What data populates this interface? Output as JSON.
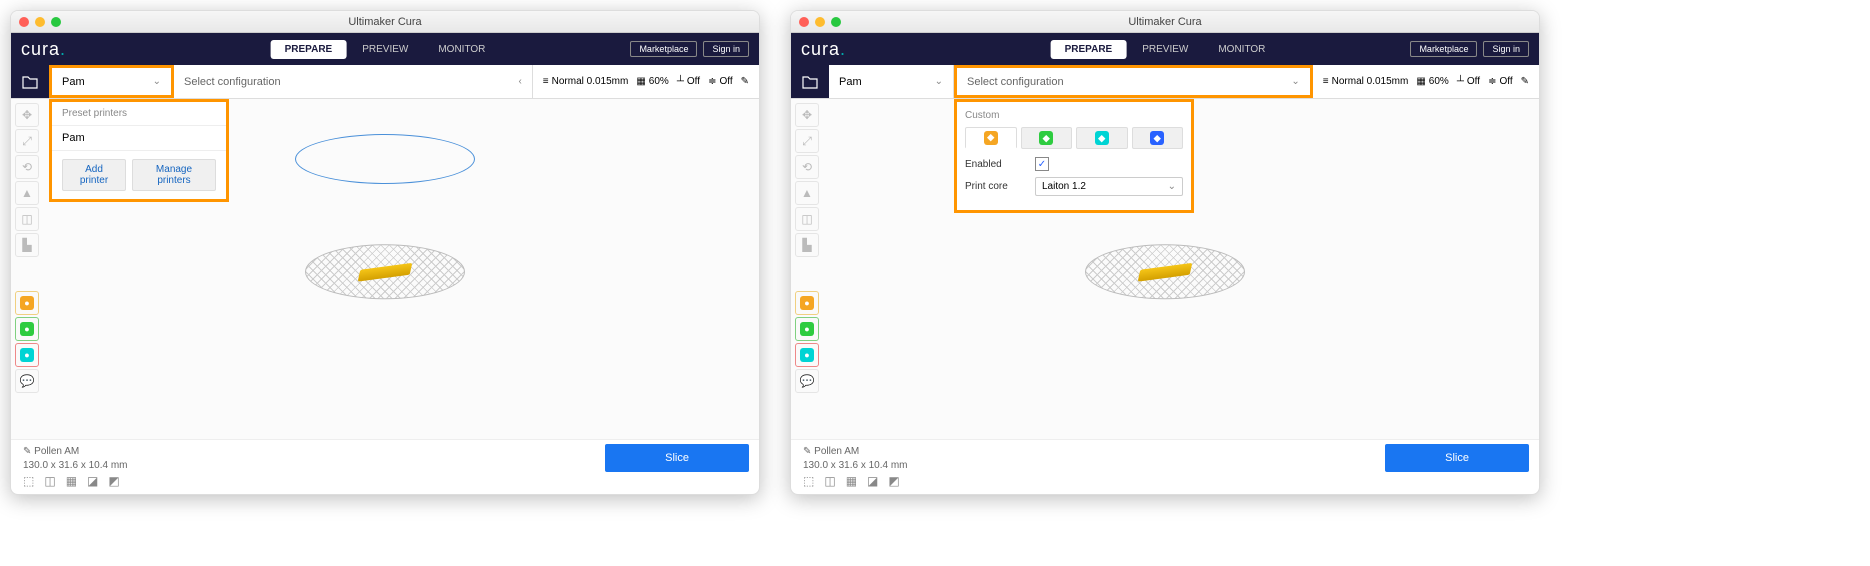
{
  "window": {
    "title": "Ultimaker Cura"
  },
  "logo": "cura",
  "stages": {
    "prepare": "PREPARE",
    "preview": "PREVIEW",
    "monitor": "MONITOR"
  },
  "top_buttons": {
    "marketplace": "Marketplace",
    "signin": "Sign in"
  },
  "printer": {
    "selected": "Pam",
    "dropdown_header": "Preset printers",
    "option": "Pam",
    "add": "Add printer",
    "manage": "Manage printers"
  },
  "config": {
    "label": "Select configuration",
    "panel_header": "Custom",
    "enabled_label": "Enabled",
    "printcore_label": "Print core",
    "printcore_value": "Laiton 1.2"
  },
  "profile": {
    "quality": "Normal 0.015mm",
    "infill": "60%",
    "support": "Off",
    "adhesion": "Off"
  },
  "model": {
    "name": "Pollen AM",
    "dims": "130.0 x 31.6 x 10.4 mm"
  },
  "slice": "Slice"
}
